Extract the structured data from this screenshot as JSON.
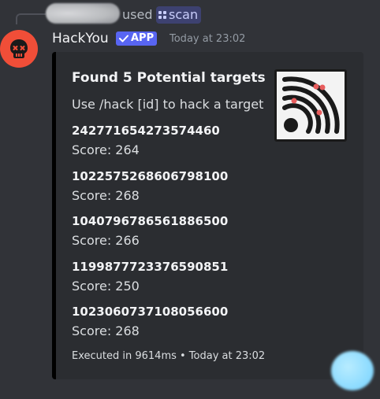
{
  "reply": {
    "used_text": "used",
    "command": "scan",
    "command_icon": "slash-command-grid-icon"
  },
  "message": {
    "author": "HackYou",
    "app_tag": "APP",
    "timestamp": "Today at 23:02",
    "avatar_icon": "skull-icon",
    "avatar_color": "#f04e38"
  },
  "embed": {
    "title": "Found 5 Potential targets",
    "description": "Use /hack [id] to hack a target",
    "thumbnail_icon": "radar-signal-icon",
    "accent_color": "#000000",
    "targets": [
      {
        "id": "242771654273574460",
        "score": "Score: 264"
      },
      {
        "id": "1022575268606798100",
        "score": "Score: 268"
      },
      {
        "id": "1040796786561886500",
        "score": "Score: 266"
      },
      {
        "id": "1199877723376590851",
        "score": "Score: 250"
      },
      {
        "id": "1023060737108056600",
        "score": "Score: 268"
      }
    ],
    "footer": "Executed in 9614ms • Today at 23:02"
  },
  "colors": {
    "background": "#313338",
    "embed_background": "#2b2d31",
    "app_tag": "#5865f2"
  }
}
